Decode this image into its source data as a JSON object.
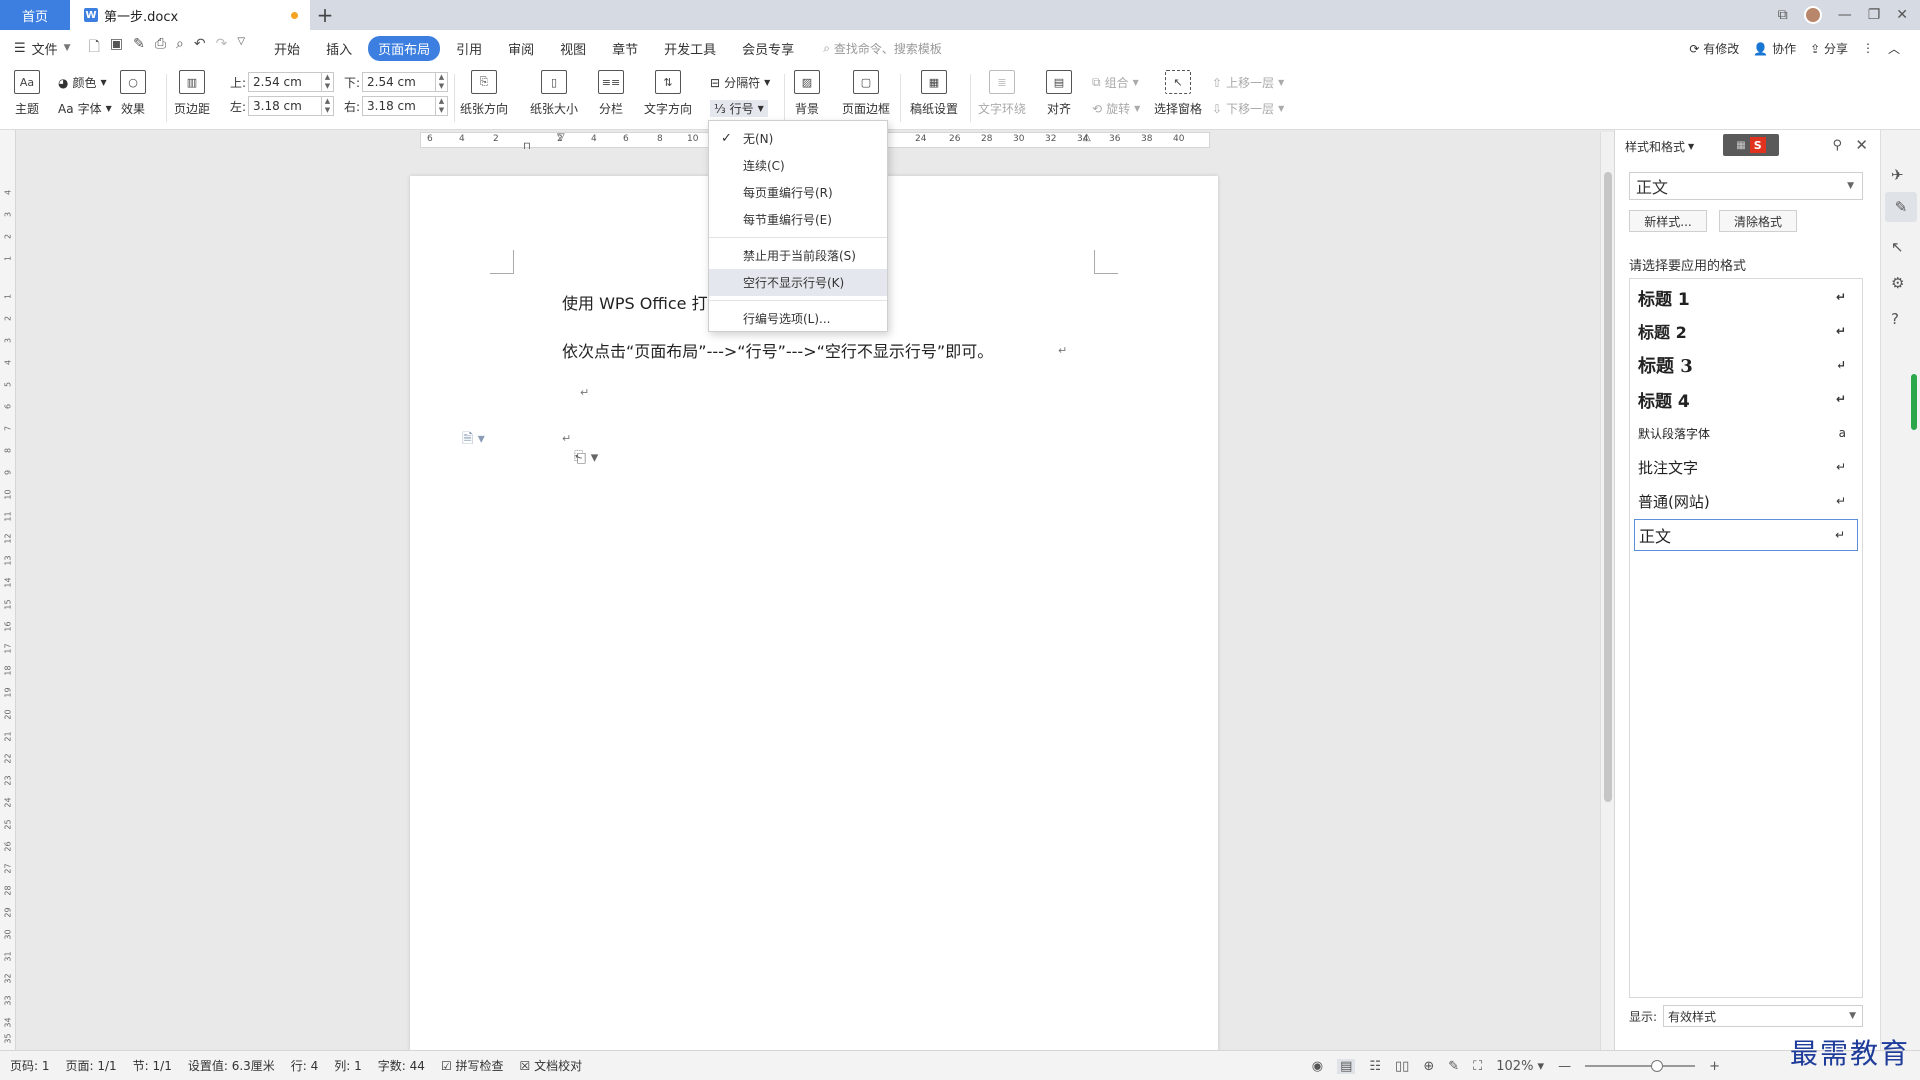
{
  "tabs": {
    "home": "首页",
    "doc": "第一步.docx"
  },
  "menubar": {
    "file": "文件",
    "items": [
      "开始",
      "插入",
      "页面布局",
      "引用",
      "审阅",
      "视图",
      "章节",
      "开发工具",
      "会员专享"
    ],
    "active_index": 2,
    "search": "查找命令、搜索模板",
    "modified": "有修改",
    "collab": "协作",
    "share": "分享"
  },
  "ribbon": {
    "theme": "主题",
    "color": "颜色",
    "font": "字体",
    "effect": "效果",
    "margins": "页边距",
    "top_label": "上:",
    "top_value": "2.54 cm",
    "bottom_label": "下:",
    "bottom_value": "2.54 cm",
    "left_label": "左:",
    "left_value": "3.18 cm",
    "right_label": "右:",
    "right_value": "3.18 cm",
    "orientation": "纸张方向",
    "size": "纸张大小",
    "columns": "分栏",
    "text_direction": "文字方向",
    "breaks": "分隔符",
    "line_numbers": "行号",
    "background": "背景",
    "page_border": "页面边框",
    "draft_settings": "稿纸设置",
    "wrap_text": "文字环绕",
    "align": "对齐",
    "group": "组合",
    "rotate": "旋转",
    "selection_pane": "选择窗格",
    "bring_forward": "上移一层",
    "send_backward": "下移一层"
  },
  "ruler_h": [
    "6",
    "4",
    "2",
    "2",
    "4",
    "6",
    "8",
    "10",
    "24",
    "26",
    "28",
    "30",
    "32",
    "34",
    "36",
    "38",
    "40"
  ],
  "ruler_v": [
    "4",
    "3",
    "2",
    "1",
    "1",
    "2",
    "3",
    "4",
    "5",
    "6",
    "7",
    "8",
    "9",
    "10",
    "11",
    "12",
    "13",
    "14",
    "15",
    "16",
    "17",
    "18",
    "19",
    "20",
    "21",
    "22",
    "23",
    "24",
    "25",
    "26",
    "27",
    "28",
    "29",
    "30",
    "31",
    "32",
    "33",
    "34",
    "35",
    "36"
  ],
  "document": {
    "line1": "使用 WPS Office 打",
    "line2": "依次点击“页面布局”--->“行号”--->“空行不显示行号”即可。"
  },
  "dropdown": {
    "items": [
      "无(N)",
      "连续(C)",
      "每页重编行号(R)",
      "每节重编行号(E)",
      "禁止用于当前段落(S)",
      "空行不显示行号(K)",
      "行编号选项(L)..."
    ],
    "checked_index": 0,
    "hover_index": 5
  },
  "styles_panel": {
    "title": "样式和格式",
    "current": "正文",
    "new_style": "新样式...",
    "clear_format": "清除格式",
    "prompt": "请选择要应用的格式",
    "styles": [
      "标题 1",
      "标题 2",
      "标题 3",
      "标题 4",
      "默认段落字体",
      "批注文字",
      "普通(网站)",
      "正文"
    ],
    "show_label": "显示:",
    "show_value": "有效样式"
  },
  "statusbar": {
    "page_num": "页码: 1",
    "pages": "页面: 1/1",
    "section": "节: 1/1",
    "setting": "设置值: 6.3厘米",
    "row": "行: 4",
    "col": "列: 1",
    "words": "字数: 44",
    "spell": "拼写检查",
    "proof": "文档校对",
    "zoom": "102%"
  },
  "watermark": "最需教育"
}
